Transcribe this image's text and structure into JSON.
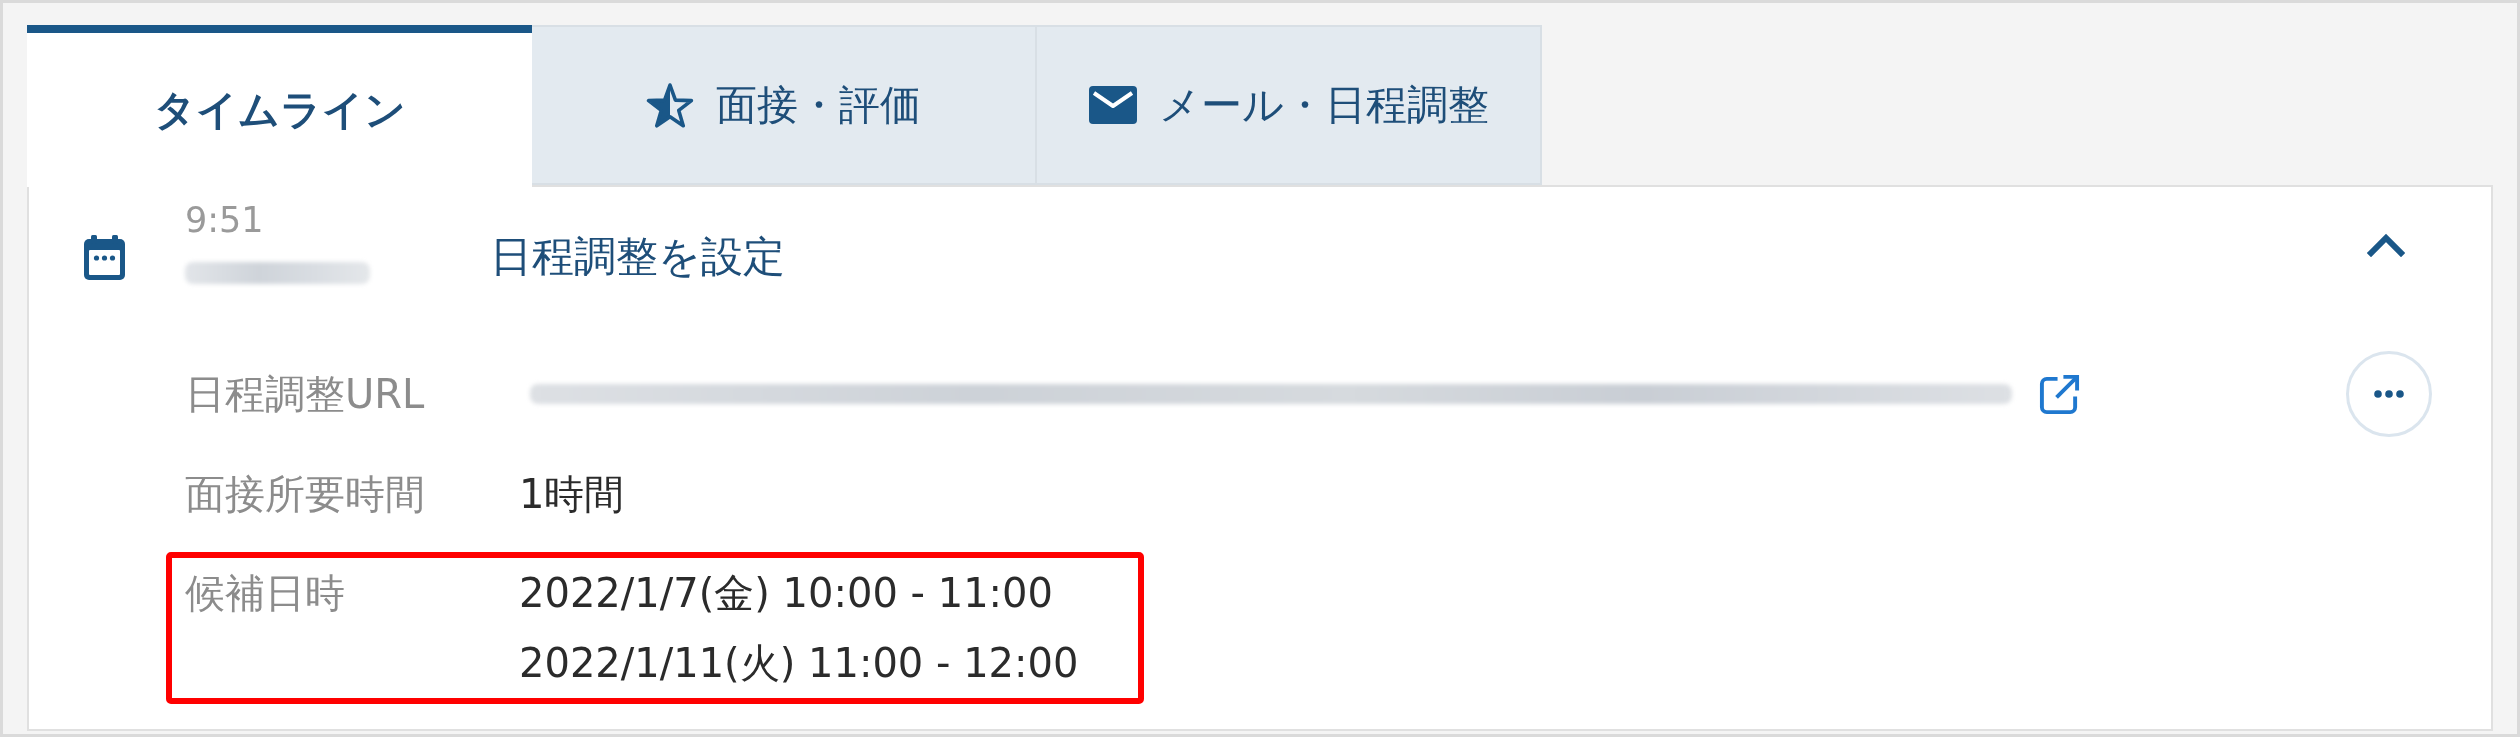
{
  "tabs": [
    {
      "label": "タイムライン",
      "selected": true
    },
    {
      "label": "面接・評価",
      "selected": false
    },
    {
      "label": "メール・日程調整",
      "selected": false
    }
  ],
  "timeline_entry": {
    "time": "9:51",
    "title": "日程調整を設定",
    "expanded": true,
    "details": [
      {
        "label": "日程調整URL",
        "kind": "link",
        "highlighted": false
      },
      {
        "label": "面接所要時間",
        "kind": "text",
        "values": [
          "1時間"
        ],
        "highlighted": false
      },
      {
        "label": "候補日時",
        "kind": "text",
        "values": [
          "2022/1/7(金) 10:00 - 11:00",
          "2022/1/11(火) 11:00 - 12:00"
        ],
        "highlighted": true
      }
    ]
  }
}
